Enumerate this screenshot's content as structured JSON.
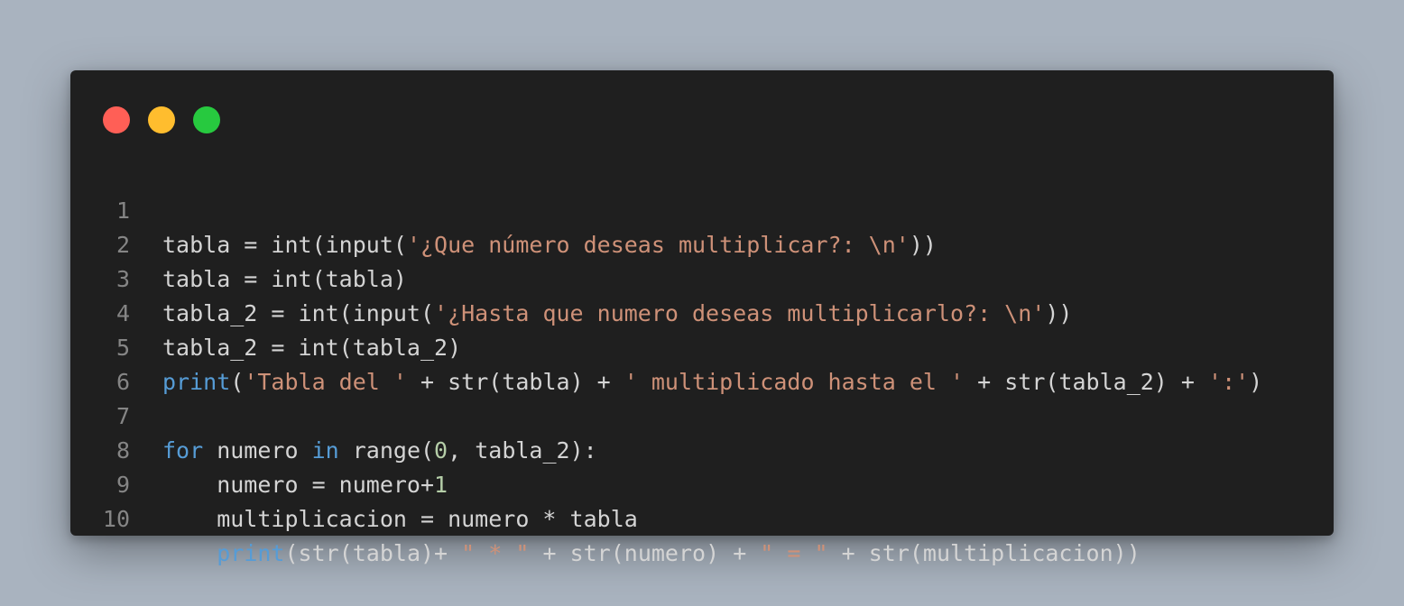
{
  "theme": {
    "page_background": "#a9b3bf",
    "window_background": "#1f1f1f",
    "line_number_color": "#858585",
    "token_colors": {
      "plain": "#d4d4d4",
      "keyword": "#569cd6",
      "string": "#ce9178",
      "number": "#b5cea8"
    }
  },
  "window_controls": [
    {
      "name": "close-button",
      "color": "#ff5f56"
    },
    {
      "name": "minimize-button",
      "color": "#ffbd2e"
    },
    {
      "name": "maximize-button",
      "color": "#27c93f"
    }
  ],
  "code": {
    "language": "python",
    "lines": [
      {
        "number": "1",
        "tokens": [
          {
            "t": "tabla = int(input(",
            "k": "plain"
          },
          {
            "t": "'¿Que número deseas multiplicar?: \\n'",
            "k": "string"
          },
          {
            "t": "))",
            "k": "plain"
          }
        ]
      },
      {
        "number": "2",
        "tokens": [
          {
            "t": "tabla = int(tabla)",
            "k": "plain"
          }
        ]
      },
      {
        "number": "3",
        "tokens": [
          {
            "t": "tabla_2 = int(input(",
            "k": "plain"
          },
          {
            "t": "'¿Hasta que numero deseas multiplicarlo?: \\n'",
            "k": "string"
          },
          {
            "t": "))",
            "k": "plain"
          }
        ]
      },
      {
        "number": "4",
        "tokens": [
          {
            "t": "tabla_2 = int(tabla_2)",
            "k": "plain"
          }
        ]
      },
      {
        "number": "5",
        "tokens": [
          {
            "t": "print",
            "k": "keyword"
          },
          {
            "t": "(",
            "k": "plain"
          },
          {
            "t": "'Tabla del '",
            "k": "string"
          },
          {
            "t": " + str(tabla) + ",
            "k": "plain"
          },
          {
            "t": "' multiplicado hasta el '",
            "k": "string"
          },
          {
            "t": " + str(tabla_2) + ",
            "k": "plain"
          },
          {
            "t": "':'",
            "k": "string"
          },
          {
            "t": ")",
            "k": "plain"
          }
        ]
      },
      {
        "number": "6",
        "tokens": []
      },
      {
        "number": "7",
        "tokens": [
          {
            "t": "for",
            "k": "keyword"
          },
          {
            "t": " numero ",
            "k": "plain"
          },
          {
            "t": "in",
            "k": "keyword"
          },
          {
            "t": " range(",
            "k": "plain"
          },
          {
            "t": "0",
            "k": "number"
          },
          {
            "t": ", tabla_2):",
            "k": "plain"
          }
        ]
      },
      {
        "number": "8",
        "tokens": [
          {
            "t": "    numero = numero+",
            "k": "plain"
          },
          {
            "t": "1",
            "k": "number"
          }
        ]
      },
      {
        "number": "9",
        "tokens": [
          {
            "t": "    multiplicacion = numero * tabla",
            "k": "plain"
          }
        ]
      },
      {
        "number": "10",
        "tokens": [
          {
            "t": "    ",
            "k": "plain"
          },
          {
            "t": "print",
            "k": "keyword"
          },
          {
            "t": "(str(tabla)+ ",
            "k": "plain"
          },
          {
            "t": "\" * \"",
            "k": "string"
          },
          {
            "t": " + str(numero) + ",
            "k": "plain"
          },
          {
            "t": "\" = \"",
            "k": "string"
          },
          {
            "t": " + str(multiplicacion))",
            "k": "plain"
          }
        ]
      }
    ]
  }
}
